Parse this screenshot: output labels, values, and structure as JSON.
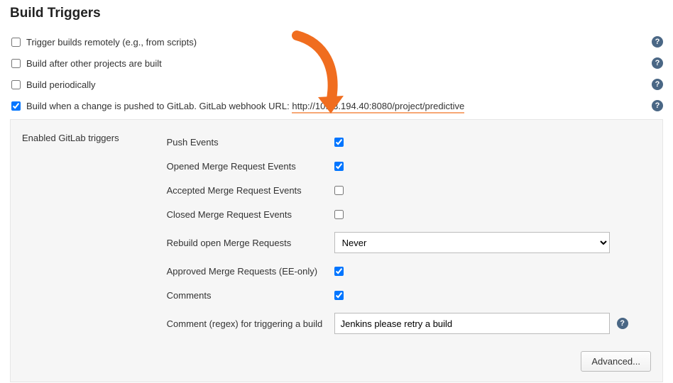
{
  "section_title": "Build Triggers",
  "triggers": {
    "remote": {
      "label": "Trigger builds remotely (e.g., from scripts)",
      "checked": false
    },
    "after_projects": {
      "label": "Build after other projects are built",
      "checked": false
    },
    "periodically": {
      "label": "Build periodically",
      "checked": false
    },
    "gitlab": {
      "label_prefix": "Build when a change is pushed to GitLab. GitLab webhook URL: ",
      "webhook_url": "http://10.13.194.40:8080/project/predictive",
      "checked": true
    }
  },
  "gitlab_panel": {
    "subsection_label": "Enabled GitLab triggers",
    "options": {
      "push_events": {
        "label": "Push Events",
        "checked": true
      },
      "opened_mr": {
        "label": "Opened Merge Request Events",
        "checked": true
      },
      "accepted_mr": {
        "label": "Accepted Merge Request Events",
        "checked": false
      },
      "closed_mr": {
        "label": "Closed Merge Request Events",
        "checked": false
      },
      "rebuild_open_mr": {
        "label": "Rebuild open Merge Requests",
        "value": "Never"
      },
      "approved_mr": {
        "label": "Approved Merge Requests (EE-only)",
        "checked": true
      },
      "comments": {
        "label": "Comments",
        "checked": true
      },
      "comment_regex": {
        "label": "Comment (regex) for triggering a build",
        "value": "Jenkins please retry a build"
      }
    },
    "advanced_label": "Advanced..."
  },
  "help_glyph": "?"
}
